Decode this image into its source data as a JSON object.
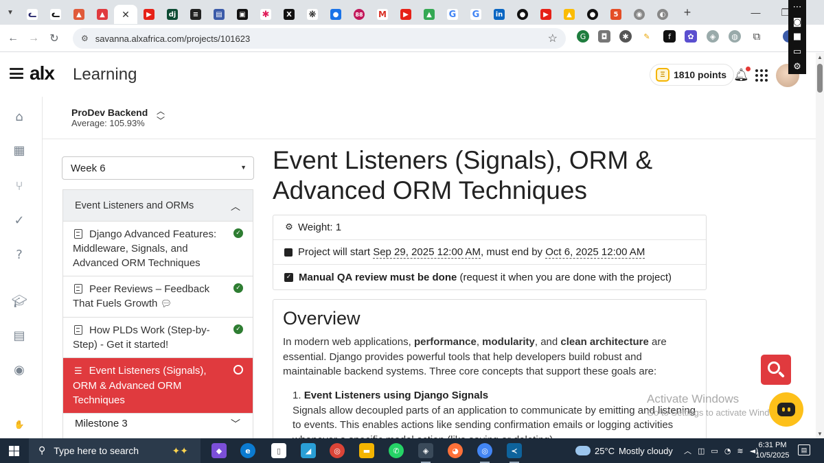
{
  "browser": {
    "tabs_count_badge": "88",
    "url": "savanna.alxafrica.com/projects/101623"
  },
  "app": {
    "logo": "alx",
    "product": "Learning",
    "points": "1810 points"
  },
  "course": {
    "title": "ProDev Backend",
    "average": "Average: 105.93%"
  },
  "sidebar": {
    "week": "Week 6",
    "module_title": "Event Listeners and ORMs",
    "items": [
      {
        "label": "Django Advanced Features: Middleware, Signals, and Advanced ORM Techniques",
        "status": "done"
      },
      {
        "label": "Peer Reviews – Feedback That Fuels Growth",
        "status": "done"
      },
      {
        "label": "How PLDs Work (Step-by-Step) - Get it started!",
        "status": "done"
      },
      {
        "label": "Event Listeners (Signals), ORM & Advanced ORM Techniques",
        "status": "current"
      }
    ],
    "milestone": "Milestone 3"
  },
  "project": {
    "title": "Event Listeners (Signals), ORM & Advanced ORM Techniques",
    "weight": "Weight: 1",
    "start_prefix": "Project will start",
    "start_date": "Sep 29, 2025 12:00 AM",
    "end_prefix": ", must end by",
    "end_date": "Oct 6, 2025 12:00 AM",
    "qa_bold": "Manual QA review must be done",
    "qa_rest": "(request it when you are done with the project)"
  },
  "overview": {
    "heading": "Overview",
    "p_a": "In modern web applications,",
    "p_b1": "performance",
    "p_b2": "modularity",
    "p_c": ", and",
    "p_b3": "clean architecture",
    "p_d": "are essential. Django provides powerful tools that help developers build robust and maintainable backend systems. Three core concepts that support these goals are:",
    "li_num": "1.",
    "li_title": "Event Listeners using Django Signals",
    "li_text": "Signals allow decoupled parts of an application to communicate by emitting and listening to events. This enables actions like sending confirmation emails or logging activities whenever a specific model action (like saving or deleting)"
  },
  "watermark": {
    "title": "Activate Windows",
    "sub": "Go to Settings to activate Windows."
  },
  "taskbar": {
    "search_placeholder": "Type here to search",
    "weather_temp": "25°C",
    "weather_desc": "Mostly cloudy",
    "time": "6:31 PM",
    "date": "10/5/2025"
  },
  "colors": {
    "accent_red": "#e03a3e",
    "done_green": "#2e7d32",
    "points_gold": "#f4b400",
    "chat_yellow": "#fdc01a"
  }
}
